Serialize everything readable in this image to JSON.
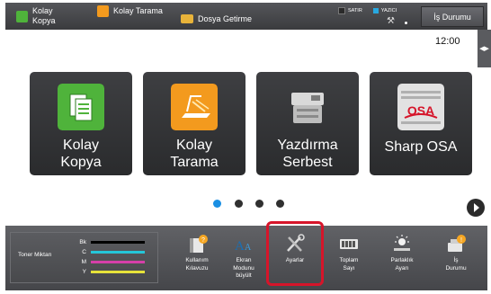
{
  "topbar": {
    "kolay_kopya_line1": "Kolay",
    "kolay_kopya_line2": "Kopya",
    "kolay_tarama": "Kolay Tarama",
    "dosya_getirme": "Dosya Getirme",
    "satir": "SATIR",
    "yazici": "YAZICI",
    "is_durumu": "İş Durumu"
  },
  "clock": "12:00",
  "tiles": [
    {
      "line1": "Kolay",
      "line2": "Kopya"
    },
    {
      "line1": "Kolay",
      "line2": "Tarama"
    },
    {
      "line1": "Yazdırma",
      "line2": "Serbest"
    },
    {
      "line1": "Sharp OSA",
      "line2": ""
    }
  ],
  "pager": {
    "count": 4,
    "active": 0
  },
  "toner": {
    "title": "Toner Miktarı",
    "rows": [
      {
        "label": "Bk",
        "color": "#000000",
        "level": 1.0
      },
      {
        "label": "C",
        "color": "#25c6d8",
        "level": 1.0
      },
      {
        "label": "M",
        "color": "#d53fa8",
        "level": 1.0
      },
      {
        "label": "Y",
        "color": "#e6e23a",
        "level": 1.0
      }
    ]
  },
  "bottom_items": [
    {
      "name": "kullanim-kilavuzu",
      "label": "Kullanım\nKılavuzu",
      "icon": "guide-icon"
    },
    {
      "name": "ekran-modunu-buyult",
      "label": "Ekran\nModunu\nbüyült",
      "icon": "font-enlarge-icon"
    },
    {
      "name": "ayarlar",
      "label": "Ayarlar",
      "icon": "tools-icon"
    },
    {
      "name": "toplam-sayi",
      "label": "Toplam\nSayı",
      "icon": "counter-icon"
    },
    {
      "name": "parlaklik-ayari",
      "label": "Parlaklık\nAyarı",
      "icon": "brightness-icon"
    },
    {
      "name": "is-durumu",
      "label": "İş\nDurumu",
      "icon": "job-status-icon"
    }
  ],
  "colors": {
    "accent_blue": "#1a8fe3",
    "highlight_red": "#d6152a"
  }
}
